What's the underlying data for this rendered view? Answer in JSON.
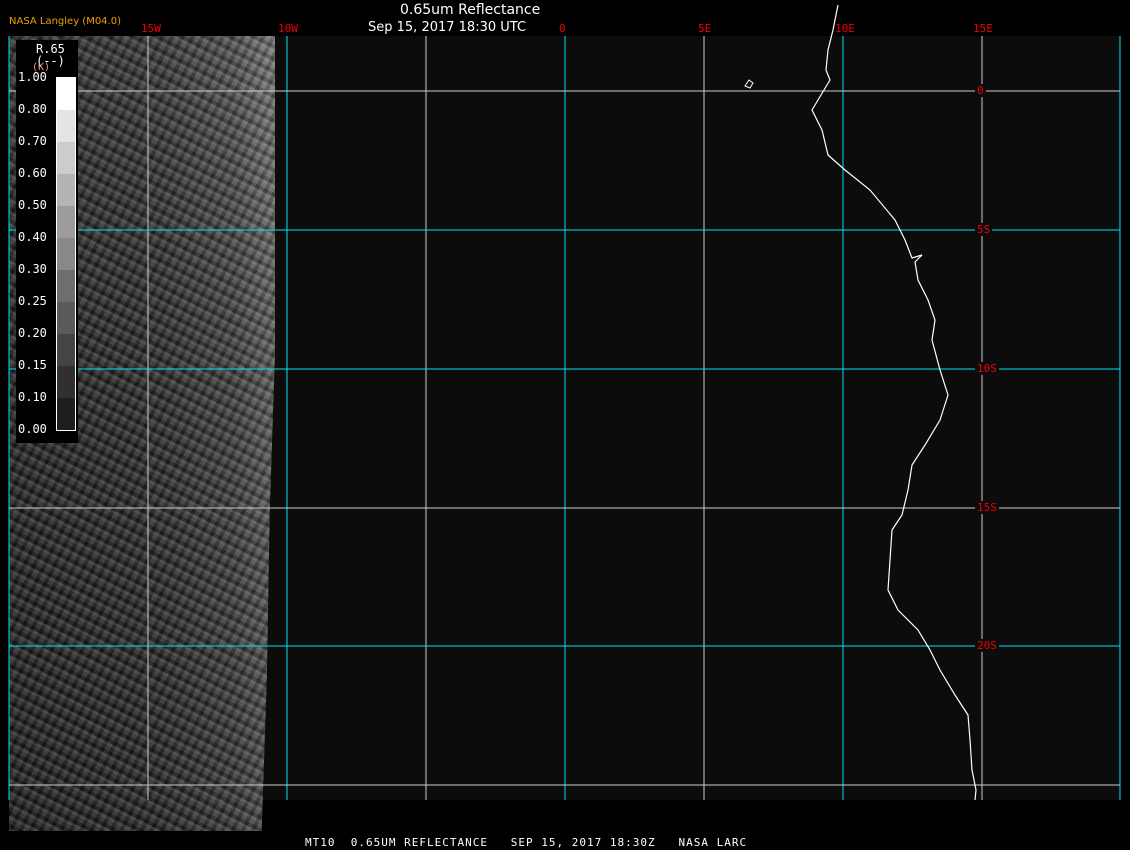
{
  "header": {
    "title": "0.65um Reflectance",
    "datetime": "Sep 15, 2017 18:30 UTC",
    "agency": "NASA Langley (M04.0)"
  },
  "longitude_labels": [
    "15W",
    "10W",
    "0",
    "5E",
    "10E",
    "15E"
  ],
  "latitude_labels": [
    "0",
    "5S",
    "10S",
    "15S",
    "20S"
  ],
  "legend": {
    "name": "R.65",
    "units": "(--)",
    "unit_k": "(K)",
    "ticks": [
      "1.00",
      "0.80",
      "0.70",
      "0.60",
      "0.50",
      "0.40",
      "0.30",
      "0.25",
      "0.20",
      "0.15",
      "0.10",
      "0.00"
    ],
    "colors": [
      "#ffffff",
      "#e4e4e4",
      "#cccccc",
      "#b4b4b4",
      "#9c9c9c",
      "#888888",
      "#6e6e6e",
      "#5a5a5a",
      "#444444",
      "#303030",
      "#1e1e1e",
      "#0c0c0c"
    ]
  },
  "footer": "MT10  0.65UM REFLECTANCE   SEP 15, 2017 18:30Z   NASA LARC",
  "colors": {
    "grid_major": "#00e5ee",
    "grid_minor": "#cccccc",
    "label_red": "#ee0000",
    "agency": "#f0a000"
  }
}
